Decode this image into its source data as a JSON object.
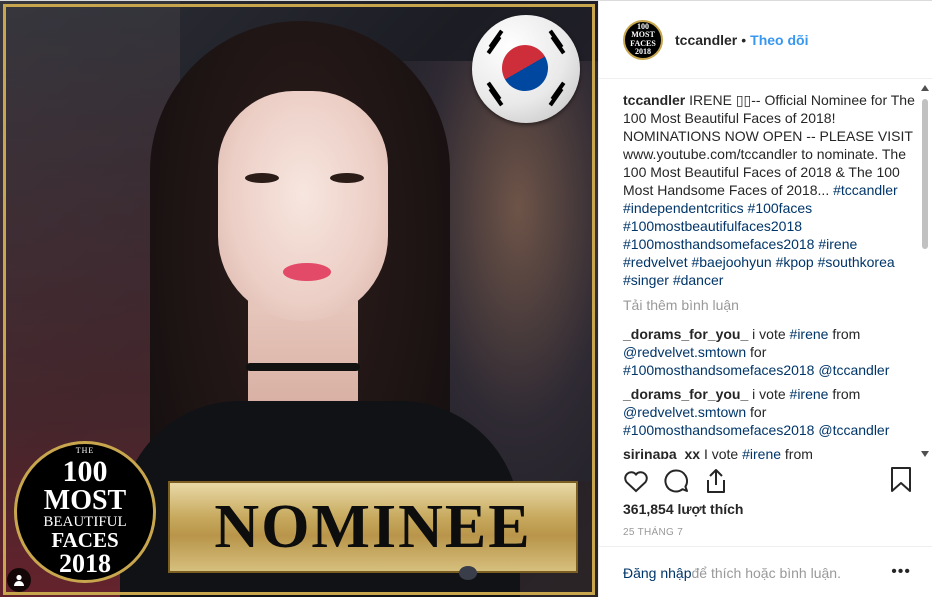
{
  "media": {
    "badge": {
      "the": "THE",
      "hundred": "100",
      "most": "MOST",
      "beautiful": "BEAUTIFUL",
      "faces": "FACES",
      "year": "2018"
    },
    "banner_text": "NOMINEE"
  },
  "header": {
    "username": "tccandler",
    "separator": "•",
    "follow": "Theo dõi",
    "avatar_text": "100 MOST FACES 2018"
  },
  "caption": {
    "username": "tccandler",
    "text_before": "IRENE ▯▯-- Official Nominee for The 100 Most Beautiful Faces of 2018! NOMINATIONS NOW OPEN -- PLEASE VISIT www.youtube.com/tccandler to nominate. The 100 Most Beautiful Faces of 2018 & The 100 Most Handsome Faces of 2018... ",
    "hashtags": [
      "#tccandler",
      "#independentcritics",
      "#100faces",
      "#100mostbeautifulfaces2018",
      "#100mosthandsomefaces2018",
      "#irene",
      "#redvelvet",
      "#baejoohyun",
      "#kpop",
      "#southkorea",
      "#singer",
      "#dancer"
    ]
  },
  "load_more": "Tải thêm bình luận",
  "comments": [
    {
      "user": "_dorams_for_you_",
      "pre": " i vote ",
      "tag1": "#irene",
      "mid": " from ",
      "mention": "@redvelvet.smtown",
      "for": " for ",
      "tag2": "#100mosthandsomefaces2018",
      "sp": " ",
      "mention2": "@tccandler"
    },
    {
      "user": "_dorams_for_you_",
      "pre": " i vote ",
      "tag1": "#irene",
      "mid": " from ",
      "mention": "@redvelvet.smtown",
      "for": " for ",
      "tag2": "#100mosthandsomefaces2018",
      "sp": " ",
      "mention2": "@tccandler"
    },
    {
      "user": "sirinapa_xx",
      "pre": " I vote ",
      "tag1": "#irene",
      "mid": " from",
      "mention": "",
      "for": "",
      "tag2": "",
      "sp": "",
      "mention2": ""
    }
  ],
  "likes": "361,854 lượt thích",
  "date": "25 THÁNG 7",
  "comment_box": {
    "login": "Đăng nhập",
    "rest": " để thích hoặc bình luận.",
    "options": "•••"
  },
  "colors": {
    "link": "#003569",
    "follow": "#3897f0",
    "gold": "#c8a64d"
  }
}
